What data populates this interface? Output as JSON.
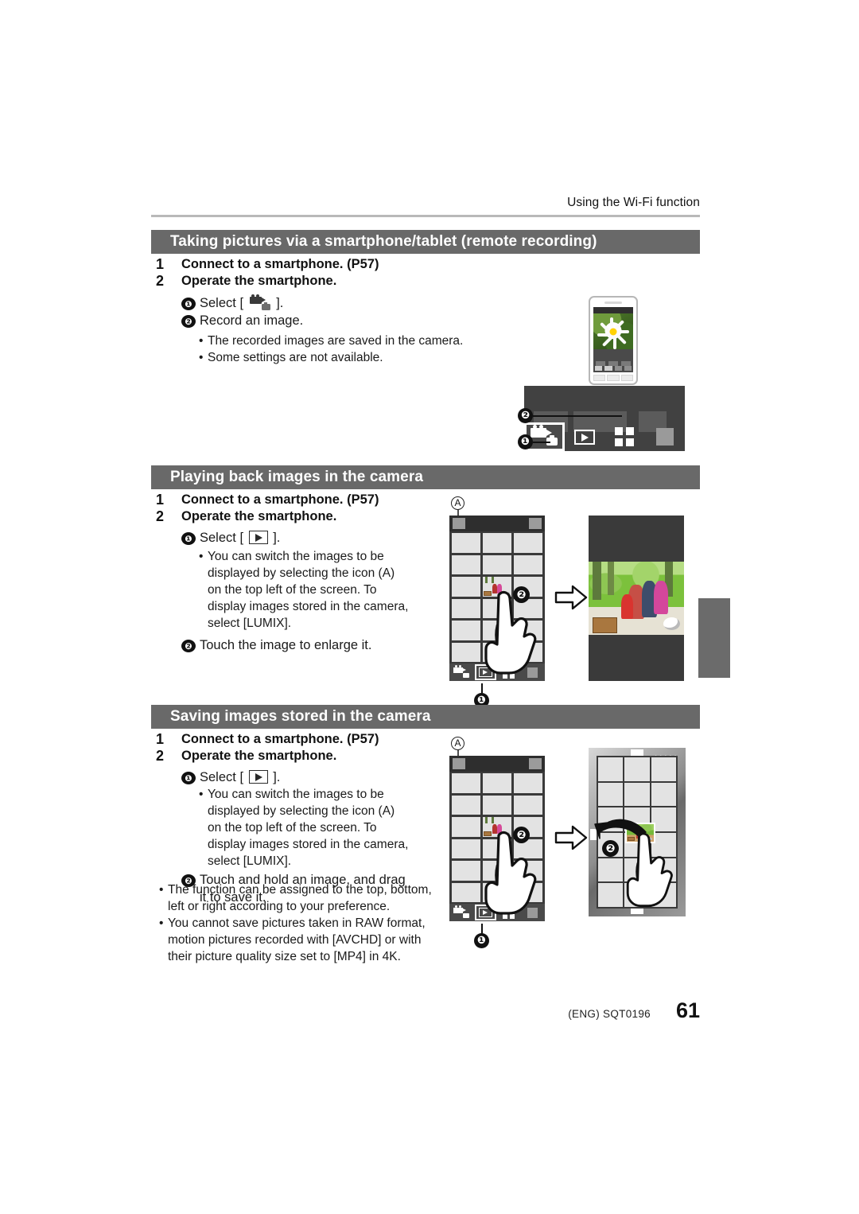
{
  "running_head": "Using the Wi-Fi function",
  "sections": [
    {
      "id": "remote-recording",
      "title": "Taking pictures via a smartphone/tablet (remote recording)",
      "steps": [
        {
          "num": "1",
          "text": "Connect to a smartphone. (P57)"
        },
        {
          "num": "2",
          "text": "Operate the smartphone."
        }
      ],
      "sub_steps": [
        {
          "num": "❶",
          "before": "Select [",
          "icon": "movie-camera-icon",
          "after": "]."
        },
        {
          "num": "❷",
          "before": "Record an image.",
          "icon": "",
          "after": ""
        }
      ],
      "bullets": [
        "The recorded images are saved in the camera.",
        "Some settings are not available."
      ]
    },
    {
      "id": "playing-back",
      "title": "Playing back images in the camera",
      "steps": [
        {
          "num": "1",
          "text": "Connect to a smartphone. (P57)"
        },
        {
          "num": "2",
          "text": "Operate the smartphone."
        }
      ],
      "sub_steps": [
        {
          "num": "❶",
          "before": "Select [",
          "icon": "play-icon",
          "after": "]."
        },
        {
          "num": "❷",
          "before": "Touch the image to enlarge it.",
          "icon": "",
          "after": ""
        }
      ],
      "bullet_lines": [
        "You can switch the images to be",
        "displayed by selecting the icon (A)",
        "on the top left of the screen. To",
        "display images stored in the camera,",
        "select [LUMIX]."
      ]
    },
    {
      "id": "saving-images",
      "title": "Saving images stored in the camera",
      "steps": [
        {
          "num": "1",
          "text": "Connect to a smartphone. (P57)"
        },
        {
          "num": "2",
          "text": "Operate the smartphone."
        }
      ],
      "sub_steps": [
        {
          "num": "❶",
          "before": "Select [",
          "icon": "play-icon",
          "after": "]."
        },
        {
          "num": "❷",
          "before": "Touch and hold an image, and drag",
          "icon": "",
          "after": "it to save it."
        }
      ],
      "bullet_lines": [
        "You can switch the images to be",
        "displayed by selecting the icon (A)",
        "on the top left of the screen. To",
        "display images stored in the camera,",
        "select [LUMIX]."
      ],
      "notes": [
        [
          "The function can be assigned to the top, bottom,",
          "left or right according to your preference."
        ],
        [
          "You cannot save pictures taken in RAW format,",
          "motion pictures recorded with [AVCHD] or with",
          "their picture quality size set to [MP4] in 4K."
        ]
      ]
    }
  ],
  "callouts": {
    "label_a": "A",
    "marker_1": "❶",
    "marker_2": "❷"
  },
  "icons": {
    "movie_camera": "movie-camera-icon",
    "play": "play-icon",
    "grid4": "four-square-grid-icon",
    "blank": "blank-tile-icon"
  },
  "footer": {
    "code": "(ENG) SQT0196",
    "page_number": "61"
  },
  "colors": {
    "section_bar": "#696969",
    "rule": "#b9b9b9",
    "device_dark": "#3a3a3a",
    "thumb": "#e3e3e3",
    "margin_tab": "#6b6b6b"
  }
}
